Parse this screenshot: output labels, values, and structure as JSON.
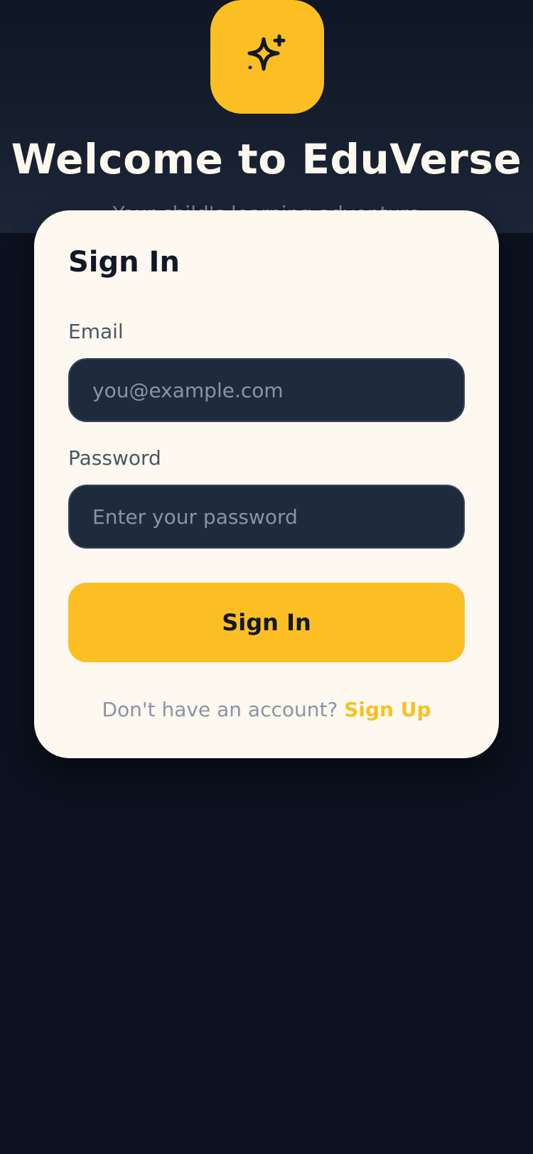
{
  "colors": {
    "accent": "#fbbf24",
    "background": "#0b111e",
    "card": "#fdf9f0",
    "input": "#1f2a3d"
  },
  "logo": {
    "icon": "sparkle-icon"
  },
  "hero": {
    "title": "Welcome to EduVerse",
    "subtitle": "Your child's learning adventure"
  },
  "form": {
    "title": "Sign In",
    "email": {
      "label": "Email",
      "placeholder": "you@example.com",
      "value": ""
    },
    "password": {
      "label": "Password",
      "placeholder": "Enter your password",
      "value": ""
    },
    "submit_label": "Sign In",
    "footer": {
      "prompt": "Don't have an account?",
      "link": "Sign Up"
    }
  }
}
